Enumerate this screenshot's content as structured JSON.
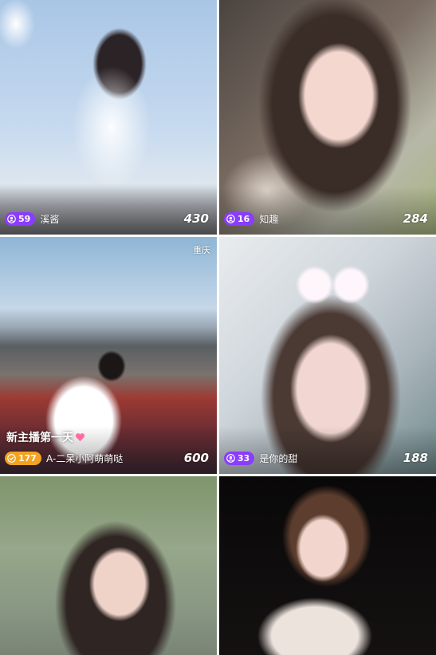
{
  "cards": [
    {
      "badge_value": "59",
      "badge_color": "#8a3cff",
      "name": "溪酱",
      "viewers": "430",
      "location": "",
      "tag": ""
    },
    {
      "badge_value": "16",
      "badge_color": "#8a3cff",
      "name": "知趣",
      "viewers": "284",
      "location": "",
      "tag": ""
    },
    {
      "badge_value": "177",
      "badge_color": "#f1a321",
      "name": "A-二呆小阿萌萌哒",
      "viewers": "600",
      "location": "重庆",
      "tag": "新主播第一天"
    },
    {
      "badge_value": "33",
      "badge_color": "#8a3cff",
      "name": "是你的甜",
      "viewers": "188",
      "location": "",
      "tag": ""
    },
    {
      "badge_value": "",
      "badge_color": "",
      "name": "",
      "viewers": "",
      "location": "",
      "tag": ""
    },
    {
      "badge_value": "",
      "badge_color": "",
      "name": "",
      "viewers": "",
      "location": "",
      "tag": ""
    }
  ],
  "icons": {
    "level_badge": "anchor-level-icon",
    "heart": "heart-icon"
  },
  "colors": {
    "heart": "#ff6fa5",
    "text": "#ffffff"
  }
}
